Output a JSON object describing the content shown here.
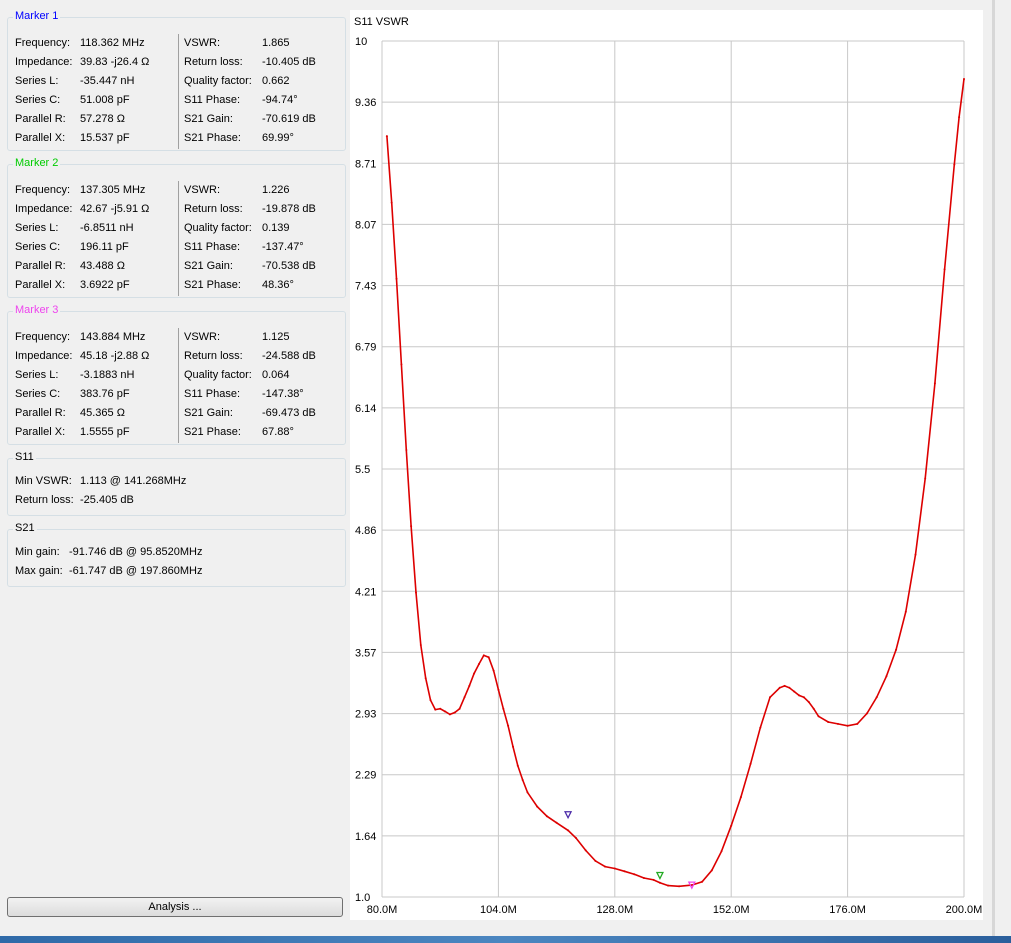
{
  "markers": [
    {
      "title": "Marker 1",
      "color": "#0000ff",
      "left": [
        {
          "label": "Frequency:",
          "value": "118.362 MHz"
        },
        {
          "label": "Impedance:",
          "value": "39.83 -j26.4 Ω"
        },
        {
          "label": "Series L:",
          "value": "-35.447 nH"
        },
        {
          "label": "Series C:",
          "value": "51.008 pF"
        },
        {
          "label": "Parallel R:",
          "value": "57.278 Ω"
        },
        {
          "label": "Parallel X:",
          "value": "15.537 pF"
        }
      ],
      "right": [
        {
          "label": "VSWR:",
          "value": "1.865"
        },
        {
          "label": "Return loss:",
          "value": "-10.405 dB"
        },
        {
          "label": "Quality factor:",
          "value": "0.662"
        },
        {
          "label": "S11 Phase:",
          "value": "-94.74°"
        },
        {
          "label": "S21 Gain:",
          "value": "-70.619 dB"
        },
        {
          "label": "S21 Phase:",
          "value": "69.99°"
        }
      ]
    },
    {
      "title": "Marker 2",
      "color": "#00cc00",
      "left": [
        {
          "label": "Frequency:",
          "value": "137.305 MHz"
        },
        {
          "label": "Impedance:",
          "value": "42.67 -j5.91 Ω"
        },
        {
          "label": "Series L:",
          "value": "-6.8511 nH"
        },
        {
          "label": "Series C:",
          "value": "196.11 pF"
        },
        {
          "label": "Parallel R:",
          "value": "43.488 Ω"
        },
        {
          "label": "Parallel X:",
          "value": "3.6922 pF"
        }
      ],
      "right": [
        {
          "label": "VSWR:",
          "value": "1.226"
        },
        {
          "label": "Return loss:",
          "value": "-19.878 dB"
        },
        {
          "label": "Quality factor:",
          "value": "0.139"
        },
        {
          "label": "S11 Phase:",
          "value": "-137.47°"
        },
        {
          "label": "S21 Gain:",
          "value": "-70.538 dB"
        },
        {
          "label": "S21 Phase:",
          "value": "48.36°"
        }
      ]
    },
    {
      "title": "Marker 3",
      "color": "#ee44ee",
      "left": [
        {
          "label": "Frequency:",
          "value": "143.884 MHz"
        },
        {
          "label": "Impedance:",
          "value": "45.18 -j2.88 Ω"
        },
        {
          "label": "Series L:",
          "value": "-3.1883 nH"
        },
        {
          "label": "Series C:",
          "value": "383.76 pF"
        },
        {
          "label": "Parallel R:",
          "value": "45.365 Ω"
        },
        {
          "label": "Parallel X:",
          "value": "1.5555 pF"
        }
      ],
      "right": [
        {
          "label": "VSWR:",
          "value": "1.125"
        },
        {
          "label": "Return loss:",
          "value": "-24.588 dB"
        },
        {
          "label": "Quality factor:",
          "value": "0.064"
        },
        {
          "label": "S11 Phase:",
          "value": "-147.38°"
        },
        {
          "label": "S21 Gain:",
          "value": "-69.473 dB"
        },
        {
          "label": "S21 Phase:",
          "value": "67.88°"
        }
      ]
    }
  ],
  "s11": {
    "title": "S11",
    "min_vswr_label": "Min VSWR:",
    "min_vswr_value": "1.113 @ 141.268MHz",
    "return_loss_label": "Return loss:",
    "return_loss_value": "-25.405 dB"
  },
  "s21": {
    "title": "S21",
    "min_gain_label": "Min gain:",
    "min_gain_value": "-91.746 dB @ 95.8520MHz",
    "max_gain_label": "Max gain:",
    "max_gain_value": "-61.747 dB @ 197.860MHz"
  },
  "analysis_button": "Analysis ...",
  "chart_data": {
    "type": "line",
    "title": "S11 VSWR",
    "xlim": [
      80,
      200
    ],
    "ylim": [
      1.0,
      10
    ],
    "x_ticks": [
      "80.0M",
      "104.0M",
      "128.0M",
      "152.0M",
      "176.0M",
      "200.0M"
    ],
    "y_ticks": [
      "10",
      "9.36",
      "8.71",
      "8.07",
      "7.43",
      "6.79",
      "6.14",
      "5.5",
      "4.86",
      "4.21",
      "3.57",
      "2.93",
      "2.29",
      "1.64",
      "1.0"
    ],
    "grid": true,
    "line_color": "#dd0000",
    "series": [
      {
        "x": [
          81,
          82,
          83,
          84,
          85,
          86,
          87,
          88,
          89,
          90,
          91,
          92,
          93,
          94,
          95,
          96,
          97,
          98,
          99,
          100,
          101,
          102,
          103,
          104,
          105,
          106,
          107,
          108,
          109,
          110,
          112,
          114,
          116,
          118.362,
          120,
          122,
          124,
          126,
          128,
          130,
          132,
          134,
          136,
          137.305,
          139,
          141.268,
          143.884,
          146,
          148,
          150,
          152,
          154,
          156,
          158,
          160,
          162,
          163,
          164,
          165,
          166,
          167,
          168,
          169,
          170,
          172,
          174,
          176,
          178,
          180,
          182,
          184,
          186,
          188,
          190,
          192,
          194,
          196,
          198,
          199,
          200
        ],
        "y": [
          9.0,
          8.3,
          7.5,
          6.6,
          5.7,
          4.9,
          4.2,
          3.65,
          3.3,
          3.07,
          2.97,
          2.98,
          2.95,
          2.92,
          2.94,
          2.98,
          3.1,
          3.22,
          3.35,
          3.45,
          3.54,
          3.52,
          3.38,
          3.18,
          2.98,
          2.8,
          2.58,
          2.38,
          2.23,
          2.1,
          1.95,
          1.85,
          1.78,
          1.7,
          1.62,
          1.49,
          1.38,
          1.32,
          1.3,
          1.27,
          1.24,
          1.2,
          1.18,
          1.15,
          1.12,
          1.113,
          1.125,
          1.16,
          1.28,
          1.48,
          1.75,
          2.05,
          2.4,
          2.78,
          3.1,
          3.2,
          3.22,
          3.2,
          3.16,
          3.12,
          3.1,
          3.05,
          2.98,
          2.9,
          2.84,
          2.82,
          2.8,
          2.82,
          2.93,
          3.1,
          3.32,
          3.6,
          4.0,
          4.6,
          5.4,
          6.4,
          7.6,
          8.7,
          9.2,
          9.6
        ]
      }
    ],
    "markers": [
      {
        "name": "Marker 1",
        "x": 118.362,
        "y": 1.865,
        "color": "#4b2aa8"
      },
      {
        "name": "Marker 2",
        "x": 137.305,
        "y": 1.226,
        "color": "#22aa22"
      },
      {
        "name": "Marker 3",
        "x": 143.884,
        "y": 1.125,
        "color": "#ee44ee"
      }
    ]
  }
}
